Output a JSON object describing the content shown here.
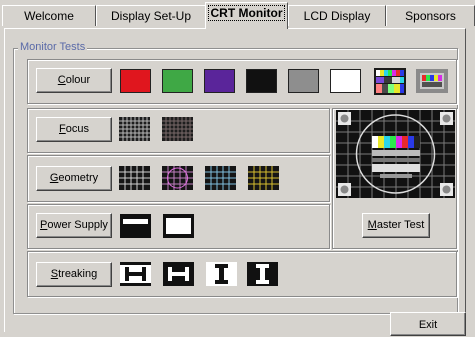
{
  "tabs": [
    "Welcome",
    "Display Set-Up",
    "CRT Monitor",
    "LCD Display",
    "Sponsors"
  ],
  "group_title": "Monitor Tests",
  "buttons": {
    "colour": {
      "prefix": "",
      "accel": "C",
      "rest": "olour"
    },
    "focus": {
      "prefix": "",
      "accel": "F",
      "rest": "ocus"
    },
    "geometry": {
      "prefix": "",
      "accel": "G",
      "rest": "eometry"
    },
    "power": {
      "prefix": "",
      "accel": "P",
      "rest": "ower Supply"
    },
    "streaking": {
      "prefix": "",
      "accel": "S",
      "rest": "treaking"
    },
    "master": {
      "prefix": "",
      "accel": "M",
      "rest": "aster Test"
    },
    "exit": "Exit"
  },
  "colour_swatches": [
    "#e0161e",
    "#3fa845",
    "#5a259a",
    "#111111",
    "#8e8e8e",
    "#ffffff"
  ],
  "icons": {
    "colour_bars": "colour-bars-pattern-icon",
    "test_card_small": "test-card-thumbnail-icon",
    "focus": "focus-grid-icon",
    "geometry": "geometry-grid-icon",
    "power": "power-supply-box-icon",
    "streaking": "streaking-pattern-icon",
    "master": "master-test-card-icon"
  }
}
